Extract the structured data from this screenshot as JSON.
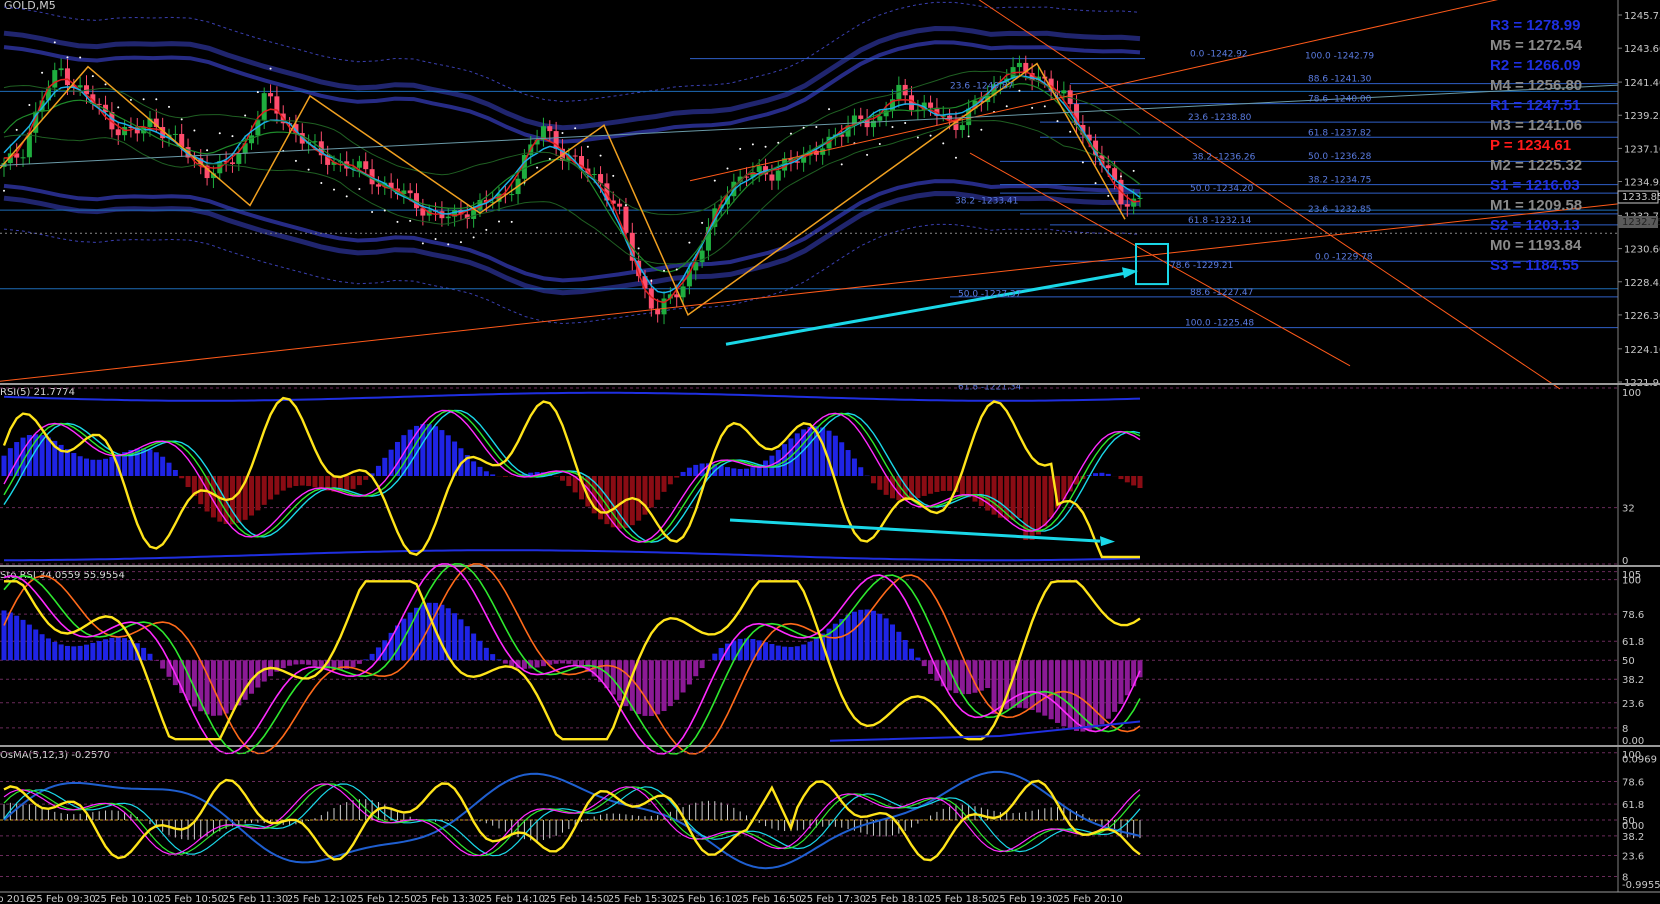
{
  "symbol": "GOLD,M5",
  "main_price_axis": [
    "1245.75",
    "1243.60",
    "1241.40",
    "1239.25",
    "1237.10",
    "1234.95",
    "1232.75",
    "1230.60",
    "1228.45",
    "1226.30",
    "1224.10",
    "1221.95"
  ],
  "current_price": "1233.85",
  "bid_box": "1232.75",
  "pivots": [
    {
      "label": "R3 = 1278.99",
      "color": "#1f2fe0"
    },
    {
      "label": "M5 = 1272.54",
      "color": "#8a8a8a"
    },
    {
      "label": "R2 = 1266.09",
      "color": "#1f2fe0"
    },
    {
      "label": "M4 = 1256.80",
      "color": "#8a8a8a"
    },
    {
      "label": "R1 = 1247.51",
      "color": "#1f2fe0"
    },
    {
      "label": "M3 = 1241.06",
      "color": "#8a8a8a"
    },
    {
      "label": "P  = 1234.61",
      "color": "#ff1a1a"
    },
    {
      "label": "M2 = 1225.32",
      "color": "#8a8a8a"
    },
    {
      "label": "S1 = 1216.03",
      "color": "#1f2fe0"
    },
    {
      "label": "M1 = 1209.58",
      "color": "#8a8a8a"
    },
    {
      "label": "S2 = 1203.13",
      "color": "#1f2fe0"
    },
    {
      "label": "M0 = 1193.84",
      "color": "#8a8a8a"
    },
    {
      "label": "S3 = 1184.55",
      "color": "#1f2fe0"
    }
  ],
  "fib_labels_right": [
    "0.0 -1242.92",
    "100.0 -1242.79",
    "88.6 -1241.30",
    "78.6 -1240.00",
    "23.6 -1238.80",
    "61.8 -1237.82",
    "38.2 -1236.26",
    "50.0 -1236.28",
    "38.2 -1234.75",
    "50.0 -1234.20",
    "23.6 -1232.85",
    "61.8 -1232.14",
    "0.0 -1229.78",
    "88.6 -1227.47",
    "100.0 -1225.48"
  ],
  "fib_labels_mid": [
    "23.6 -1240.87",
    "38.2 -1233.41",
    "78.6 -1229.21",
    "50.0 -1227.37",
    "61.8 -1221.34"
  ],
  "rsi_title": "RSI(5) 21.7774",
  "rsi_axis": [
    "100",
    "32",
    "0"
  ],
  "stoch_title": "Sto RSI 34.0559 55.9554",
  "stoch_axis": [
    "105",
    "100",
    "78.6",
    "61.8",
    "50",
    "38.2",
    "23.6",
    "8",
    "0.00"
  ],
  "osma_title": "OsMA(5,12,3) -0.2570",
  "osma_axis": [
    "100",
    "0.0969",
    "78.6",
    "61.8",
    "50",
    "0.00",
    "38.2",
    "23.6",
    "8",
    "-0.9955"
  ],
  "time_labels": [
    "25 Feb 2016",
    "25 Feb 09:30",
    "25 Feb 10:10",
    "25 Feb 10:50",
    "25 Feb 11:30",
    "25 Feb 12:10",
    "25 Feb 12:50",
    "25 Feb 13:30",
    "25 Feb 14:10",
    "25 Feb 14:50",
    "25 Feb 15:30",
    "25 Feb 16:10",
    "25 Feb 16:50",
    "25 Feb 17:30",
    "25 Feb 18:10",
    "25 Feb 18:50",
    "25 Feb 19:30",
    "25 Feb 20:10"
  ],
  "colors": {
    "bull": "#1fae3f",
    "bear": "#ff4d6d",
    "zigzag": "#f0a020",
    "cyan": "#1ad8e8",
    "band": "#2a2f9a",
    "yellow": "#ffe41a",
    "magenta": "#ff2aff",
    "green": "#2ee82e",
    "orange": "#ff6a1a",
    "hist_up": "#1f24e6",
    "hist_dn_rsi": "#8a0c14",
    "hist_dn_sto": "#8b1a95"
  },
  "chart_data": {
    "type": "line",
    "title": "GOLD,M5",
    "ylim": [
      1221.95,
      1245.75
    ],
    "close_path": [
      1235.9,
      1237.0,
      1240.2,
      1242.3,
      1241.0,
      1239.8,
      1238.5,
      1238.0,
      1238.9,
      1237.8,
      1236.5,
      1235.6,
      1235.9,
      1237.4,
      1240.4,
      1239.0,
      1237.8,
      1236.6,
      1236.2,
      1235.8,
      1235.0,
      1234.4,
      1233.6,
      1232.9,
      1232.5,
      1233.2,
      1233.6,
      1234.0,
      1236.5,
      1238.5,
      1236.8,
      1235.8,
      1235.0,
      1233.0,
      1229.0,
      1226.5,
      1227.4,
      1229.5,
      1232.2,
      1234.8,
      1235.6,
      1235.2,
      1236.4,
      1236.2,
      1237.6,
      1238.0,
      1239.2,
      1238.8,
      1240.9,
      1239.9,
      1239.4,
      1238.6,
      1239.6,
      1240.8,
      1242.4,
      1241.8,
      1241.6,
      1240.2,
      1238.0,
      1236.2,
      1233.6,
      1233.9
    ],
    "rsi_value": 21.7774,
    "stoch_rsi": [
      34.0559,
      55.9554
    ],
    "osma_value": -0.257
  }
}
